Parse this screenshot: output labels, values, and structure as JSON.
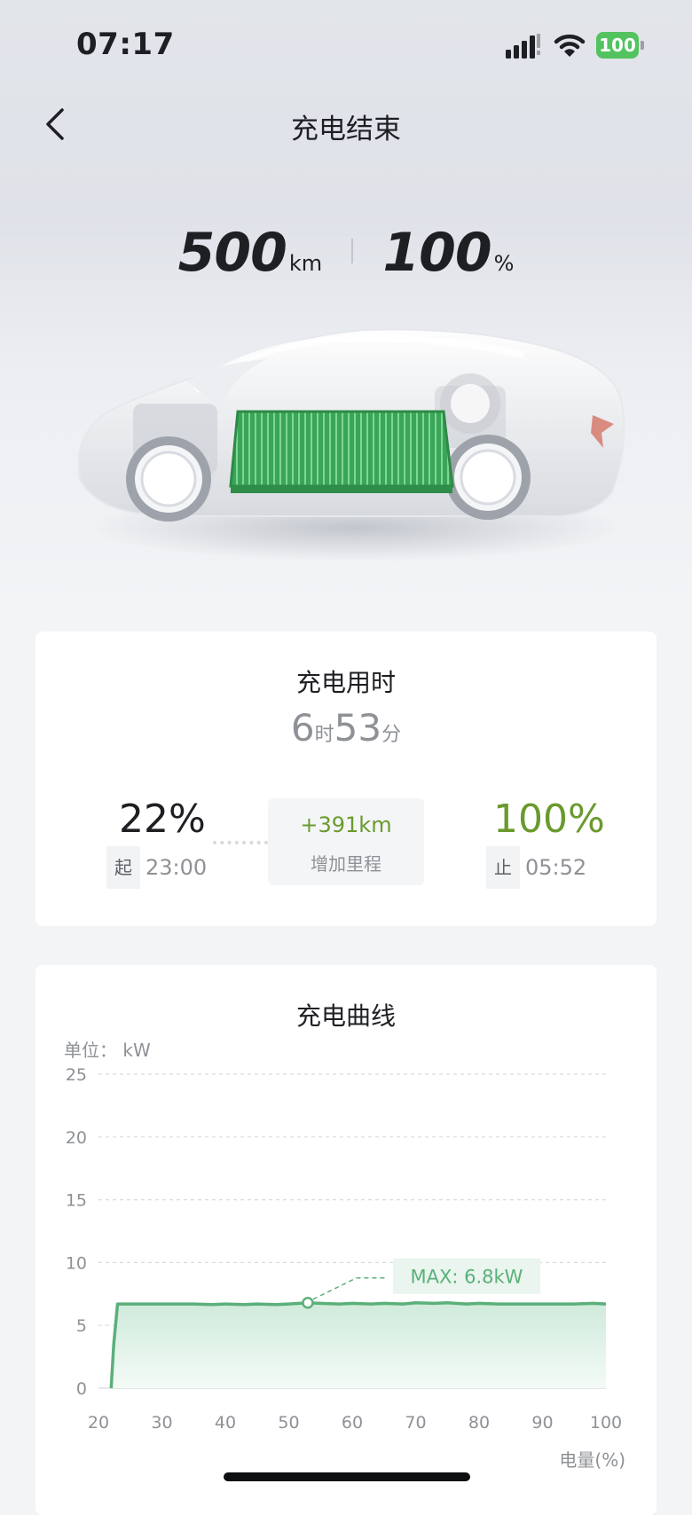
{
  "status_bar": {
    "time": "07:17",
    "battery": "100",
    "battery_color": "#52c35e"
  },
  "nav": {
    "title": "充电结束",
    "back_icon": "chevron-left-icon"
  },
  "summary": {
    "range_value": "500",
    "range_unit": "km",
    "soc_value": "100",
    "soc_unit": "%"
  },
  "duration_card": {
    "title": "充电用时",
    "hours": "6",
    "hours_unit": "时",
    "minutes": "53",
    "minutes_unit": "分",
    "start_percent": "22%",
    "start_tag": "起",
    "start_time": "23:00",
    "added_range": "+391km",
    "added_range_label": "增加里程",
    "end_percent": "100%",
    "end_tag": "止",
    "end_time": "05:52"
  },
  "curve_card": {
    "title": "充电曲线",
    "unit_label": "单位：  kW"
  },
  "chart_data": {
    "type": "area",
    "title": "充电曲线",
    "ylabel": "单位：  kW",
    "xlabel": "电量(%)",
    "xlim": [
      20,
      100
    ],
    "ylim": [
      0,
      25
    ],
    "x_ticks": [
      20,
      30,
      40,
      50,
      60,
      70,
      80,
      90,
      100
    ],
    "y_ticks": [
      0,
      5,
      10,
      15,
      20,
      25
    ],
    "grid": true,
    "color": "#5bb07a",
    "series": [
      {
        "x": [
          22,
          22.4,
          23,
          25,
          30,
          35,
          38,
          40,
          43,
          45,
          48,
          50,
          53,
          55,
          58,
          60,
          63,
          65,
          68,
          70,
          73,
          75,
          78,
          80,
          83,
          85,
          88,
          90,
          93,
          95,
          98,
          100
        ],
        "values": [
          0,
          3.5,
          6.7,
          6.7,
          6.7,
          6.7,
          6.65,
          6.7,
          6.65,
          6.7,
          6.65,
          6.7,
          6.8,
          6.75,
          6.7,
          6.75,
          6.7,
          6.75,
          6.7,
          6.8,
          6.75,
          6.8,
          6.7,
          6.75,
          6.7,
          6.7,
          6.7,
          6.7,
          6.7,
          6.7,
          6.75,
          6.7
        ]
      }
    ],
    "annotation": {
      "label": "MAX: 6.8kW",
      "x": 53,
      "y": 6.8
    }
  }
}
